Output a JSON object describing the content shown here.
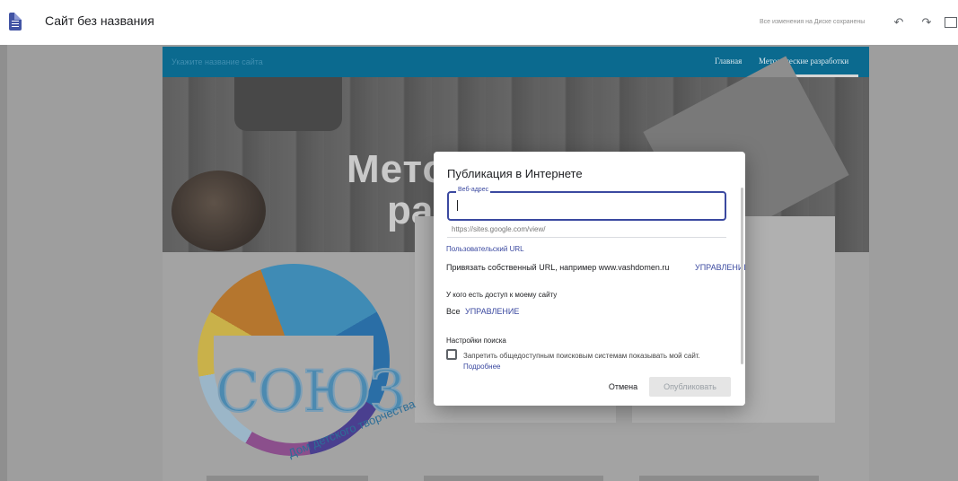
{
  "app": {
    "site_title": "Сайт без названия",
    "saved_status": "Все изменения на Диске сохранены"
  },
  "toolbar": {
    "undo_icon": "undo-icon",
    "redo_icon": "redo-icon",
    "preview_icon": "preview-icon"
  },
  "site": {
    "site_name_placeholder": "Укажите название сайта",
    "nav": [
      "Главная",
      "Методические разработки"
    ],
    "hero_title_line1": "Методические",
    "hero_title_line2": "ра",
    "logo_text": "СОЮЗ",
    "logo_subtitle": "Дом детского творчества"
  },
  "dialog": {
    "title": "Публикация в Интернете",
    "web_address_label": "Веб-адрес",
    "web_address_value": "",
    "url_prefix": "https://sites.google.com/view/",
    "custom_url_link": "Пользовательский URL",
    "bind_url_text": "Привязать собственный URL, например www.vashdomen.ru",
    "bind_url_manage": "УПРАВЛЕНИЕ",
    "access_heading": "У кого есть доступ к моему сайту",
    "access_value": "Все",
    "access_manage": "УПРАВЛЕНИЕ",
    "search_heading": "Настройки поиска",
    "search_checkbox_text": "Запретить общедоступным поисковым системам показывать мой сайт.",
    "search_checkbox_more": "Подробнее",
    "search_checkbox_checked": false,
    "cancel_label": "Отмена",
    "publish_label": "Опубликовать"
  },
  "colors": {
    "accent": "#3b49a0",
    "site_header": "#0b6a8f"
  }
}
